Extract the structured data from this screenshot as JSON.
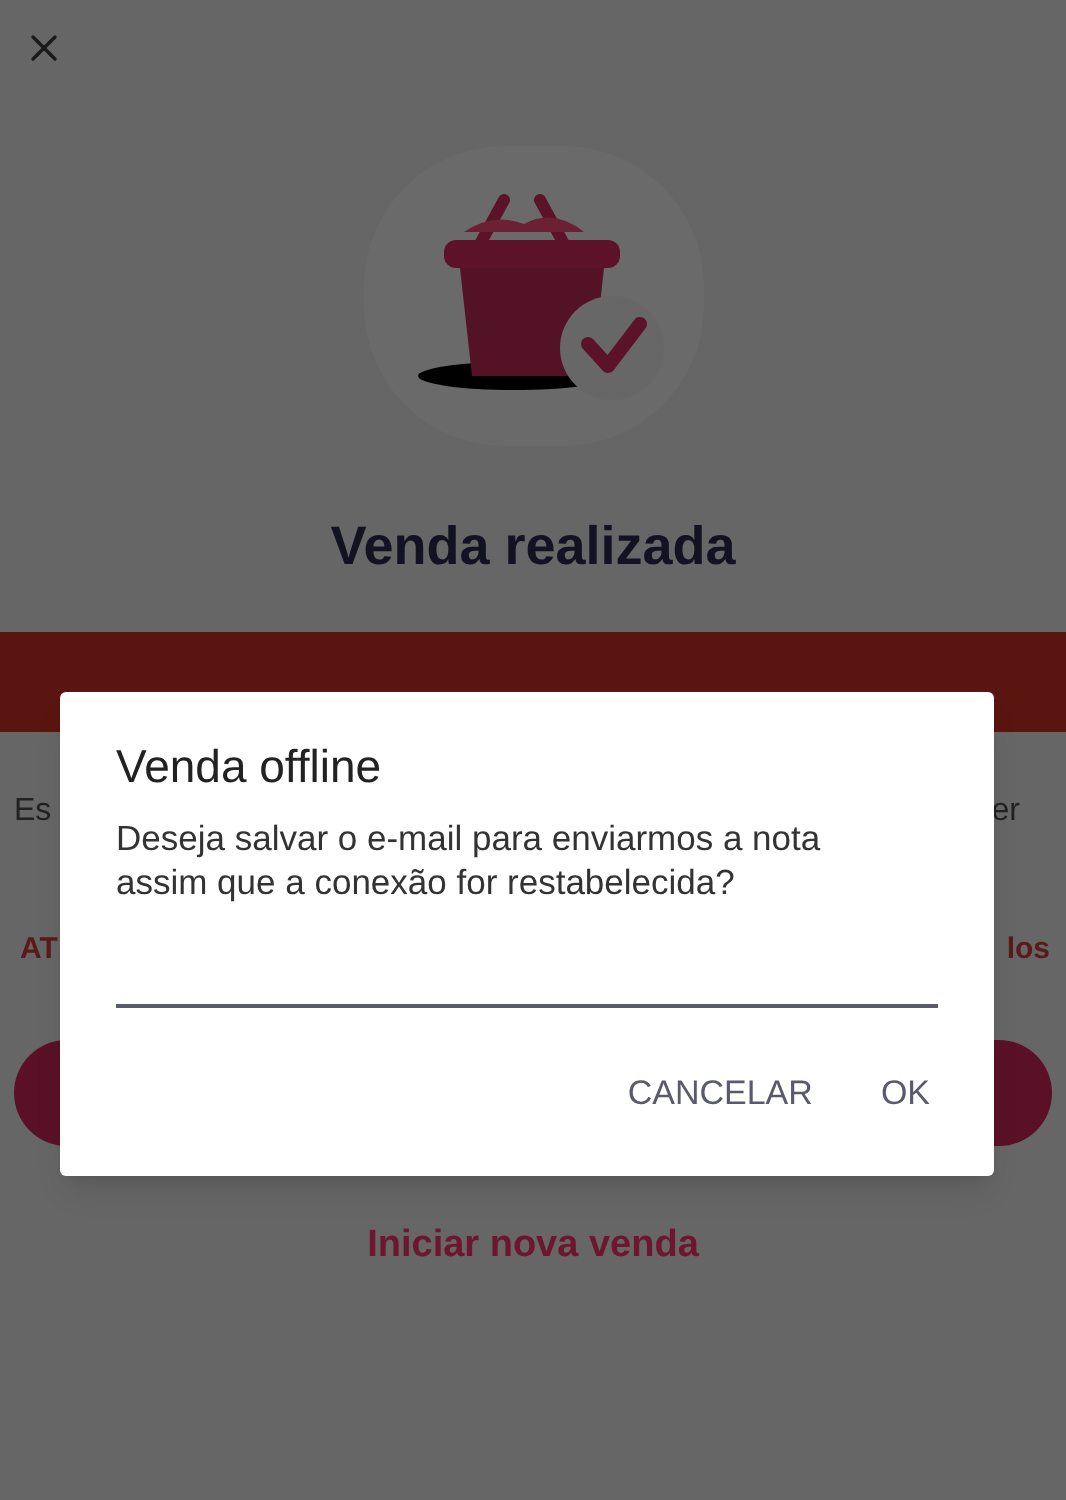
{
  "title": "Venda realizada",
  "info_text": {
    "left": "Es",
    "right": "er"
  },
  "links": {
    "left": "AT",
    "right": "los"
  },
  "secondary_link": "Iniciar nova venda",
  "dialog": {
    "title": "Venda offline",
    "message": "Deseja salvar o e-mail para enviarmos a nota assim que a conexão for restabelecida?",
    "buttons": [
      "CANCELAR",
      "OK"
    ]
  }
}
